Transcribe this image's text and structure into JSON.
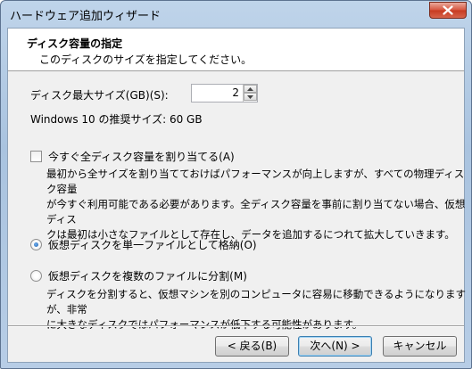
{
  "window": {
    "title": "ハードウェア追加ウィザード"
  },
  "header": {
    "title": "ディスク容量の指定",
    "subtitle": "このディスクのサイズを指定してください。"
  },
  "disk_size": {
    "label": "ディスク最大サイズ(GB)(S):",
    "value": "2",
    "recommended": "Windows 10 の推奨サイズ: 60 GB"
  },
  "allocate": {
    "label": "今すぐ全ディスク容量を割り当てる(A)",
    "checked": false,
    "description_lines": [
      "最初から全サイズを割り当てておけばパフォーマンスが向上しますが、すべての物理ディスク容量",
      "が今すぐ利用可能である必要があります。全ディスク容量を事前に割り当てない場合、仮想ディス",
      "クは最初は小さなファイルとして存在し、データを追加するにつれて拡大していきます。"
    ]
  },
  "options": {
    "single_file": {
      "label": "仮想ディスクを単一ファイルとして格納(O)",
      "selected": true
    },
    "multi_file": {
      "label": "仮想ディスクを複数のファイルに分割(M)",
      "selected": false,
      "description_lines": [
        "ディスクを分割すると、仮想マシンを別のコンピュータに容易に移動できるようになりますが、非常",
        "に大きなディスクではパフォーマンスが低下する可能性があります。"
      ]
    }
  },
  "buttons": {
    "back": "< 戻る(B)",
    "next": "次へ(N) >",
    "cancel": "キャンセル"
  },
  "colors": {
    "close_button": "#d6533c",
    "client_bg": "#f0f0f0",
    "radio_fill": "#1f5ea8"
  }
}
